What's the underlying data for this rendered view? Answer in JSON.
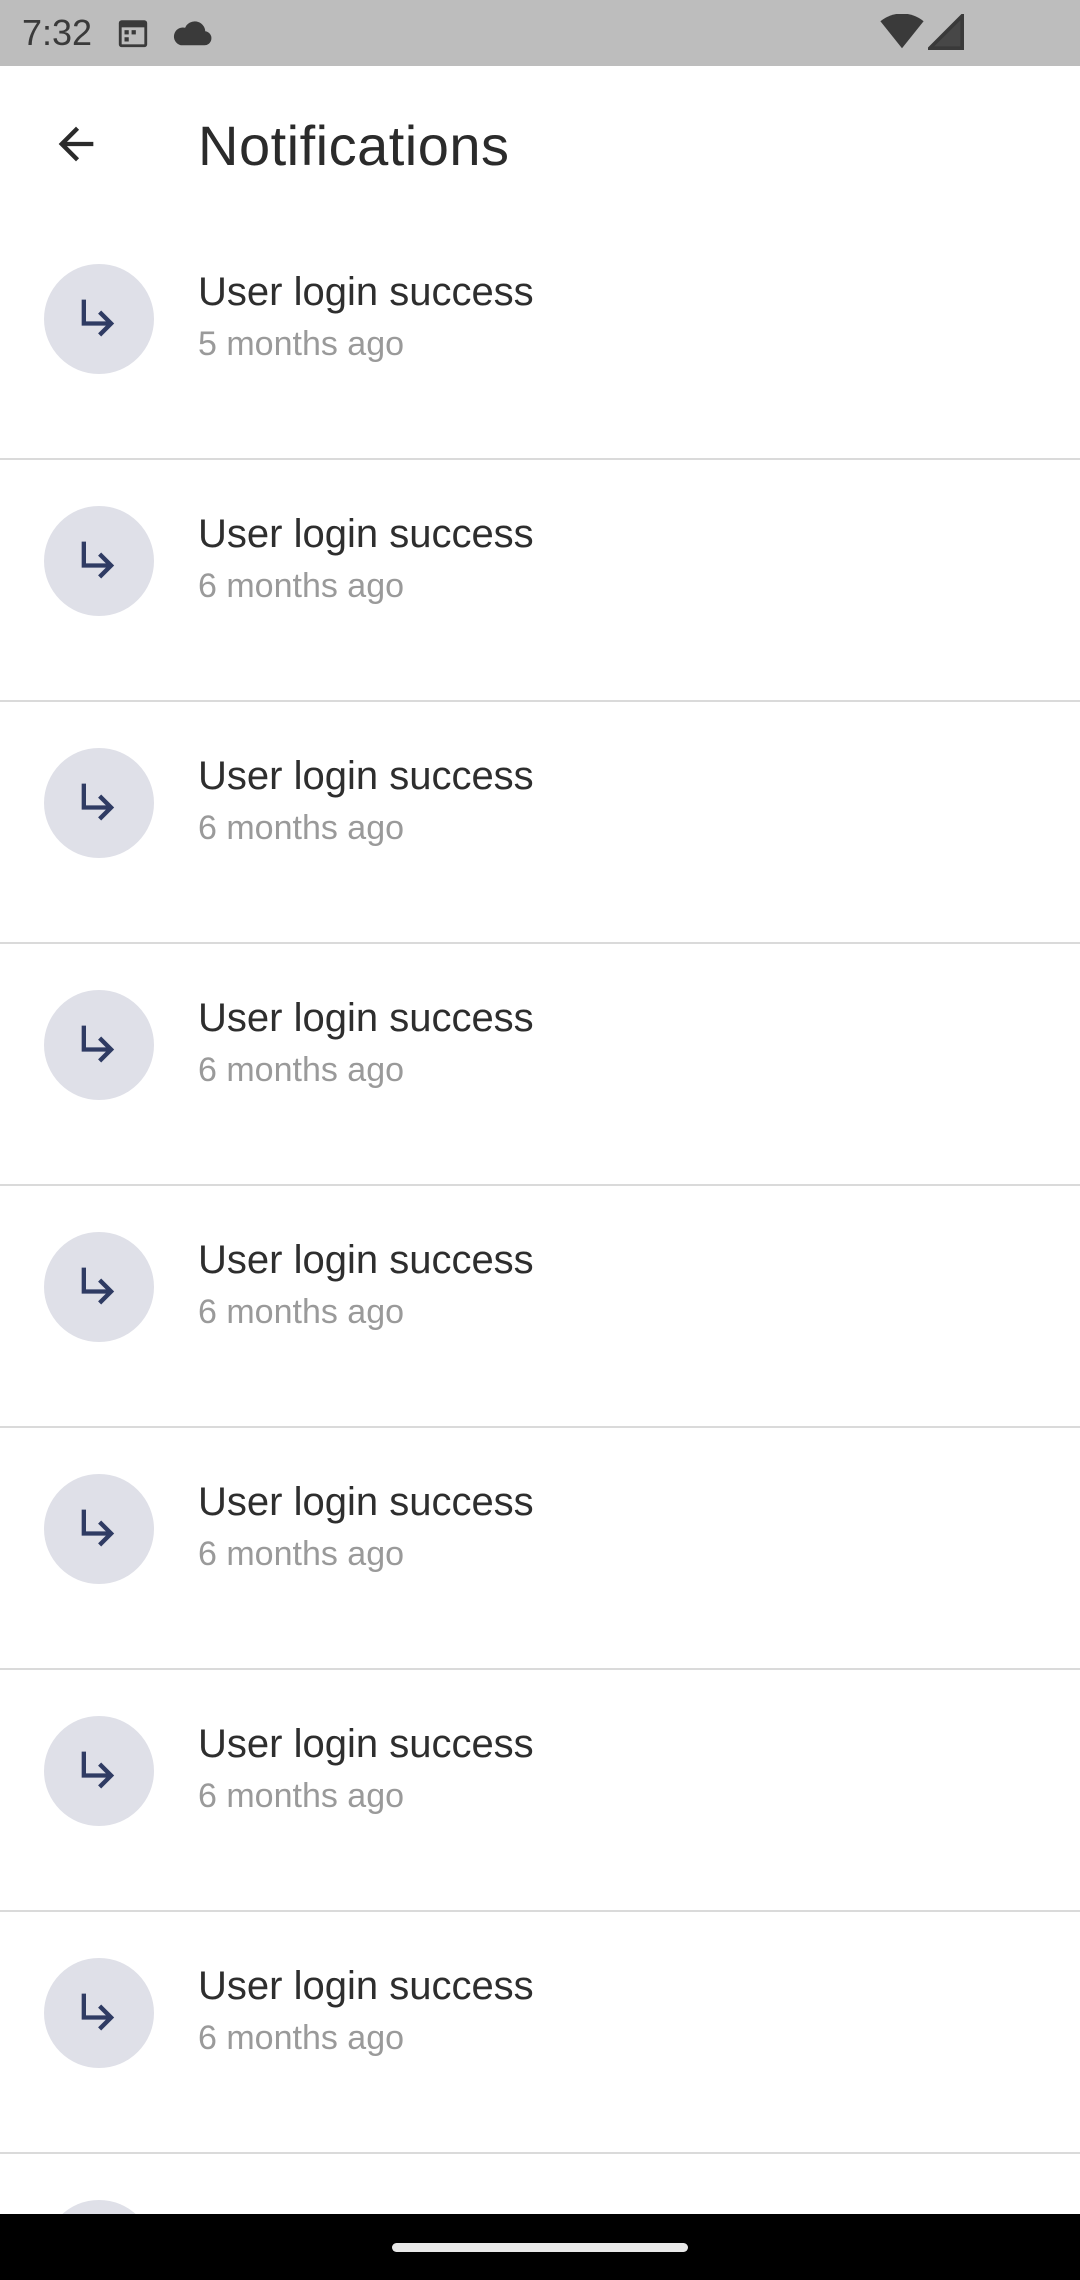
{
  "status_bar": {
    "time": "7:32",
    "icons": [
      "calendar-icon",
      "cloud-icon",
      "wifi-icon",
      "signal-icon"
    ]
  },
  "app_bar": {
    "title": "Notifications",
    "back_icon": "arrow-back-icon"
  },
  "notifications": [
    {
      "title": "User login success",
      "time": "5 months ago",
      "icon": "subdirectory-arrow-right-icon"
    },
    {
      "title": "User login success",
      "time": "6 months ago",
      "icon": "subdirectory-arrow-right-icon"
    },
    {
      "title": "User login success",
      "time": "6 months ago",
      "icon": "subdirectory-arrow-right-icon"
    },
    {
      "title": "User login success",
      "time": "6 months ago",
      "icon": "subdirectory-arrow-right-icon"
    },
    {
      "title": "User login success",
      "time": "6 months ago",
      "icon": "subdirectory-arrow-right-icon"
    },
    {
      "title": "User login success",
      "time": "6 months ago",
      "icon": "subdirectory-arrow-right-icon"
    },
    {
      "title": "User login success",
      "time": "6 months ago",
      "icon": "subdirectory-arrow-right-icon"
    },
    {
      "title": "User login success",
      "time": "6 months ago",
      "icon": "subdirectory-arrow-right-icon"
    }
  ],
  "colors": {
    "status_bar_bg": "#bdbdbd",
    "avatar_bg": "#dfe0e8",
    "icon_color": "#2f3b63",
    "title_text": "#2e2e2e",
    "subtitle_text": "#9a9a9a",
    "divider": "#dadada"
  }
}
